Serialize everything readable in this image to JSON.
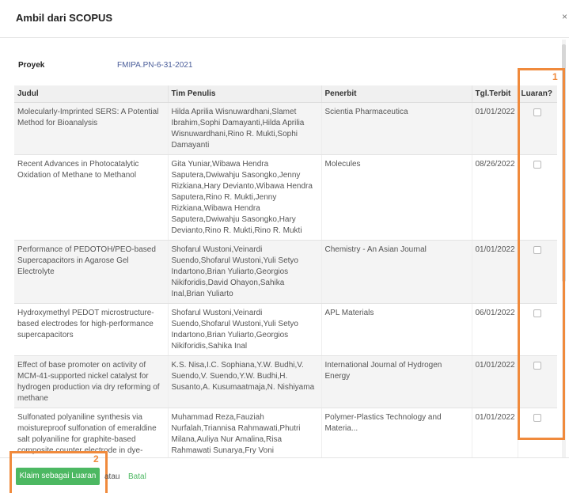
{
  "dialog": {
    "title": "Ambil dari SCOPUS",
    "close_label": "×"
  },
  "project": {
    "label": "Proyek",
    "value": "FMIPA.PN-6-31-2021"
  },
  "table": {
    "headers": {
      "judul": "Judul",
      "tim": "Tim Penulis",
      "penerbit": "Penerbit",
      "tgl": "Tgl.Terbit",
      "luaran": "Luaran?"
    },
    "rows": [
      {
        "judul": "Molecularly-Imprinted SERS: A Potential Method for Bioanalysis",
        "tim": "Hilda Aprilia Wisnuwardhani,Slamet Ibrahim,Sophi Damayanti,Hilda Aprilia Wisnuwardhani,Rino R. Mukti,Sophi Damayanti",
        "penerbit": "Scientia Pharmaceutica",
        "tgl": "01/01/2022",
        "checked": false
      },
      {
        "judul": "Recent Advances in Photocatalytic Oxidation of Methane to Methanol",
        "tim": "Gita Yuniar,Wibawa Hendra Saputera,Dwiwahju Sasongko,Jenny Rizkiana,Hary Devianto,Wibawa Hendra Saputera,Rino R. Mukti,Jenny Rizkiana,Wibawa Hendra Saputera,Dwiwahju Sasongko,Hary Devianto,Rino R. Mukti,Rino R. Mukti",
        "penerbit": "Molecules",
        "tgl": "08/26/2022",
        "checked": false
      },
      {
        "judul": "Performance of PEDOTOH/PEO-based Supercapacitors in Agarose Gel Electrolyte",
        "tim": "Shofarul Wustoni,Veinardi Suendo,Shofarul Wustoni,Yuli Setyo Indartono,Brian Yuliarto,Georgios Nikiforidis,David Ohayon,Sahika Inal,Brian Yuliarto",
        "penerbit": "Chemistry - An Asian Journal",
        "tgl": "01/01/2022",
        "checked": false
      },
      {
        "judul": "Hydroxymethyl PEDOT microstructure-based electrodes for high-performance supercapacitors",
        "tim": "Shofarul Wustoni,Veinardi Suendo,Shofarul Wustoni,Yuli Setyo Indartono,Brian Yuliarto,Georgios Nikiforidis,Sahika Inal",
        "penerbit": "APL Materials",
        "tgl": "06/01/2022",
        "checked": false
      },
      {
        "judul": "Effect of base promoter on activity of MCM-41-supported nickel catalyst for hydrogen production via dry reforming of methane",
        "tim": "K.S. Nisa,I.C. Sophiana,Y.W. Budhi,V. Suendo,V. Suendo,Y.W. Budhi,H. Susanto,A. Kusumaatmaja,N. Nishiyama",
        "penerbit": "International Journal of Hydrogen Energy",
        "tgl": "01/01/2022",
        "checked": false
      },
      {
        "judul": "Sulfonated polyaniline synthesis via moistureproof sulfonation of emeraldine salt polyaniline for graphite-based composite counter electrode in dye-sensitized solar cells",
        "tim": "Muhammad Reza,Fauziah Nurfalah,Triannisa Rahmawati,Phutri Milana,Auliya Nur Amalina,Risa Rahmawati Sunarya,Fry Voni Steky,Veinardi Suendo,Muhammad Reza,Triannisa Rahmawati,Risa Rahmawati Sunarya,Veinardi Suendo",
        "penerbit": "Polymer-Plastics Technology and Materia...",
        "tgl": "01/01/2022",
        "checked": false
      }
    ]
  },
  "annotations": {
    "one": "1",
    "two": "2"
  },
  "footer": {
    "claim_label": "Klaim sebagai Luaran",
    "or_label": "atau",
    "cancel_label": "Batal"
  },
  "colors": {
    "accent_green": "#4cb862",
    "annotation_orange": "#f08a3c",
    "project_link": "#4a5d9a"
  }
}
